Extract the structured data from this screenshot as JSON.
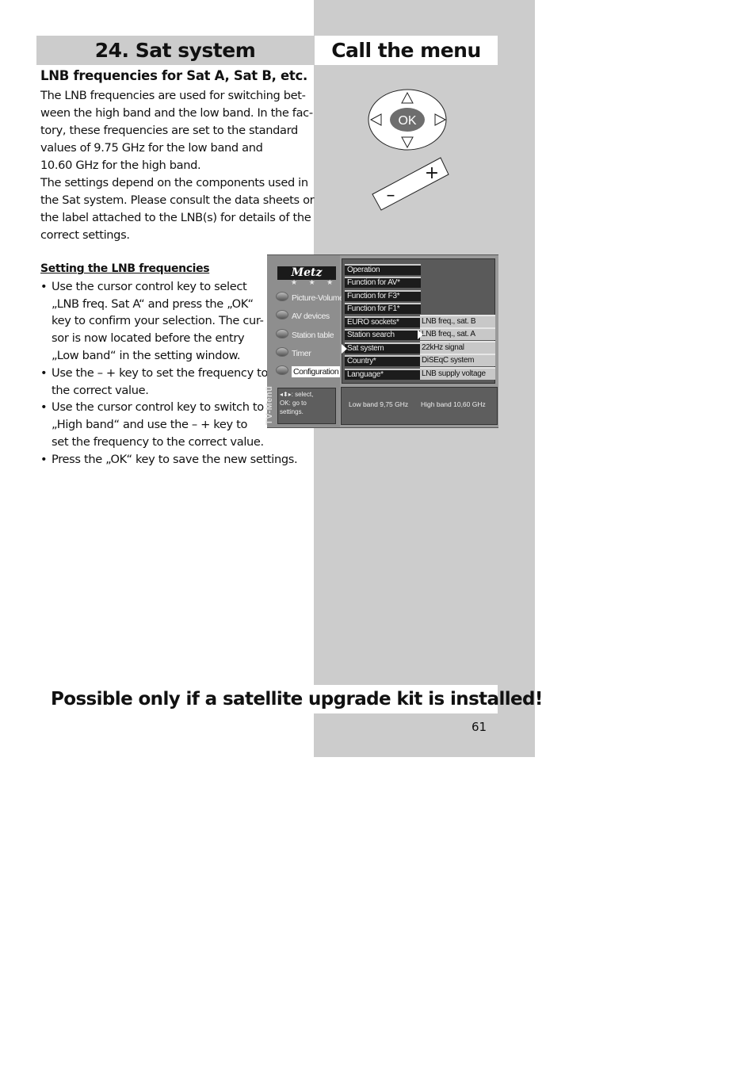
{
  "header": {
    "chapter_title": "24. Sat system",
    "right_title": "Call the menu"
  },
  "intro": {
    "subheading": "LNB frequencies for Sat A, Sat B, etc.",
    "lines": [
      "The LNB frequencies are used for switching bet-",
      "ween the high band and the low band. In the fac-",
      "tory, these frequencies are set to the standard",
      "values of 9.75 GHz for the low band and",
      "10.60 GHz for the high band.",
      "The settings depend on the components used in",
      "the Sat system. Please consult the data sheets or",
      "the label attached to the LNB(s) for details of the",
      "correct settings."
    ]
  },
  "instructions": {
    "title": "Setting the LNB frequencies",
    "bullet_symbol": "•",
    "bullets": [
      [
        "Use the cursor control key to select",
        "„LNB freq. Sat A“ and press the „OK“",
        "key to confirm your selection. The cur-",
        "sor is now located before the entry",
        "„Low band“ in the setting window."
      ],
      [
        "Use the – + key to set the frequency to",
        "the correct value."
      ],
      [
        "Use the cursor control key to switch to",
        "„High band“ and use the – + key to",
        "set the frequency to the correct value."
      ],
      [
        "Press the „OK“ key to save the new settings."
      ]
    ]
  },
  "remote": {
    "ok_label": "OK",
    "minus_label": "–",
    "plus_label": "+"
  },
  "tv_menu": {
    "logo": "Metz",
    "stars": "★ ★ ★",
    "vertical_label": "TV-Menü",
    "main_items": [
      "Picture-Volume",
      "AV devices",
      "Station table",
      "Timer",
      "Configuration"
    ],
    "selected_main": "Configuration",
    "sub_items": [
      "Operation",
      "Function for AV*",
      "Function for F3*",
      "Function for F1*",
      "EURO sockets*",
      "Station search",
      "Sat system",
      "Country*",
      "Language*"
    ],
    "selected_sub": "Sat system",
    "options": [
      "LNB freq., sat. B",
      "LNB freq., sat. A",
      "22kHz signal",
      "DiSEqC system",
      "LNB supply voltage"
    ],
    "selected_option": "LNB freq., sat. A",
    "help_lines": [
      "◂⬍▸: select,",
      "OK: go to",
      "settings."
    ],
    "low_band": "Low band 9,75 GHz",
    "high_band": "High band   10,60 GHz"
  },
  "footer": {
    "warning": "Possible only if a satellite upgrade kit is installed!",
    "page_number": "61"
  }
}
